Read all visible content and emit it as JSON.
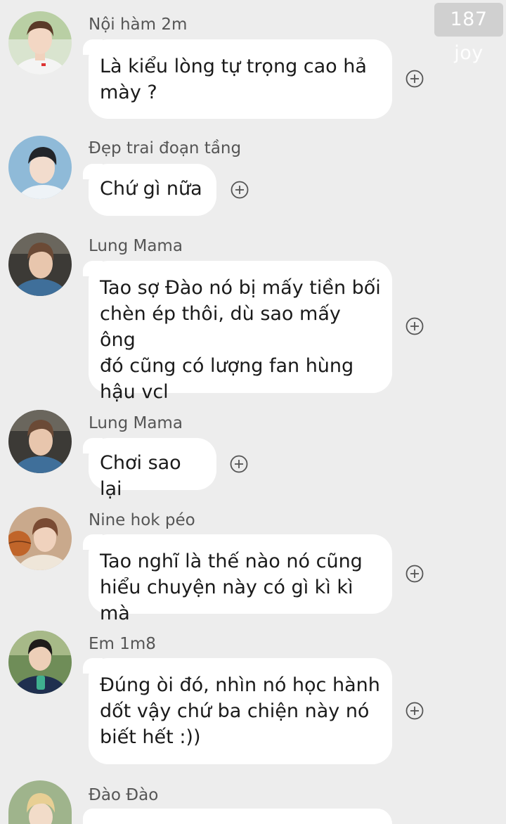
{
  "watermark": "187 joy",
  "messages": [
    {
      "sender": "Nội hàm 2m",
      "text": "Là kiểu lòng tự trọng cao hả\nmày ?",
      "avatar": "boy-white-shirt"
    },
    {
      "sender": "Đẹp trai đoạn tầng",
      "text": "Chứ gì nữa",
      "avatar": "boy-side-face"
    },
    {
      "sender": "Lung Mama",
      "text": "Tao sợ Đào nó bị mấy tiền bối\nchèn ép thôi, dù sao mấy ông\nđó cũng có lượng fan hùng\nhậu vcl",
      "avatar": "boy-denim-jacket"
    },
    {
      "sender": "Lung Mama",
      "text": "Chơi sao lại",
      "avatar": "boy-denim-jacket"
    },
    {
      "sender": "Nine hok péo",
      "text": "Tao nghĩ là thế nào nó cũng\nhiểu chuyện này có gì kì kì mà",
      "avatar": "boy-basketball"
    },
    {
      "sender": "Em 1m8",
      "text": "Đúng òi đó, nhìn nó học hành\ndốt vậy chứ ba chiện này nó\nbiết hết :))",
      "avatar": "boy-navy-tee"
    },
    {
      "sender": "Đào Đào",
      "text": "",
      "avatar": "boy-blond"
    }
  ],
  "icons": {
    "add": "plus-circle-icon"
  }
}
